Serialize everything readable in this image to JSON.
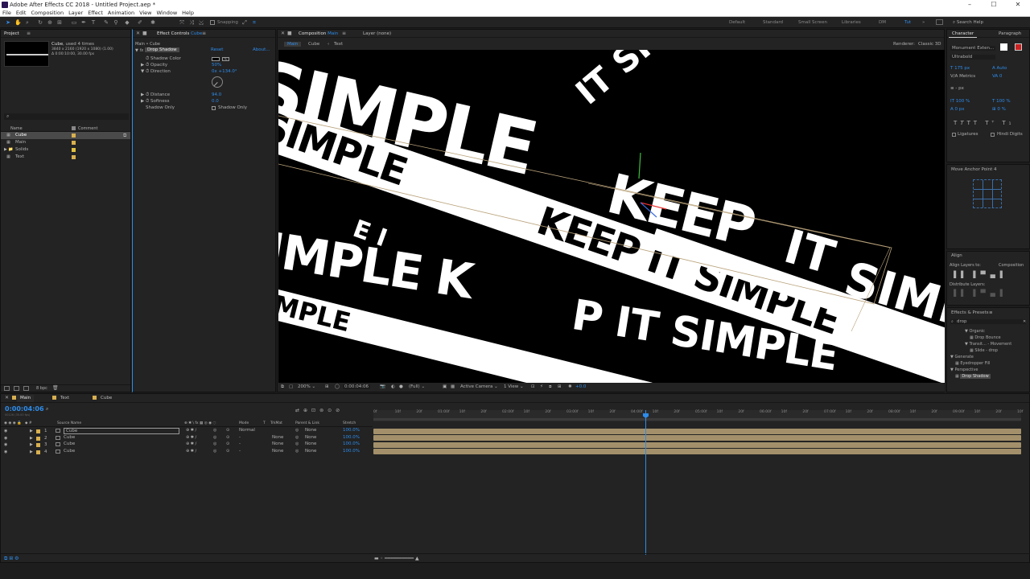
{
  "window": {
    "title": "Adobe After Effects CC 2018 - Untitled Project.aep *"
  },
  "menu": [
    "File",
    "Edit",
    "Composition",
    "Layer",
    "Effect",
    "Animation",
    "View",
    "Window",
    "Help"
  ],
  "toolbar": {
    "snapping_label": "Snapping"
  },
  "workspaces": [
    "Default",
    "Standard",
    "Small Screen",
    "Libraries",
    "DM",
    "Tut"
  ],
  "search_help": "Search Help",
  "project": {
    "tab": "Project",
    "selected_name": "Cube",
    "selected_info": ", used 4 times",
    "selected_dims": "3840 x 2160 (1920 x 1080) (1.00)",
    "selected_dur": "Δ 0:00:10:00, 30.00 fps",
    "columns": [
      "Name",
      "Comment"
    ],
    "items": [
      {
        "name": "Cube",
        "color": "#d8b050",
        "selected": true
      },
      {
        "name": "Main",
        "color": "#d8b050",
        "selected": false
      },
      {
        "name": "Solids",
        "color": "#e0c040",
        "selected": false
      },
      {
        "name": "Text",
        "color": "#d8b050",
        "selected": false
      }
    ],
    "footer_bpc": "8 bpc"
  },
  "effect_controls": {
    "tab": "Effect Controls",
    "tab_target": "Cube",
    "breadcrumb": "Main • Cube",
    "effect_name": "Drop Shadow",
    "reset": "Reset",
    "about": "About...",
    "props": [
      {
        "label": "Shadow Color",
        "value": ""
      },
      {
        "label": "Opacity",
        "value": "50%"
      },
      {
        "label": "Direction",
        "value": "0x +134.0°"
      },
      {
        "label": "Distance",
        "value": "94.0"
      },
      {
        "label": "Softness",
        "value": "0.0"
      },
      {
        "label": "Shadow Only",
        "value": "Shadow Only"
      }
    ]
  },
  "composition": {
    "tab": "Composition",
    "tab_target": "Main",
    "layer_tab": "Layer (none)",
    "crumbs": [
      "Main",
      "Cube",
      "Text"
    ],
    "renderer_label": "Renderer:",
    "renderer": "Classic 3D",
    "zoom": "200%",
    "timecode": "0:00:04:06",
    "resolution": "(Full)",
    "camera": "Active Camera",
    "view": "1 View",
    "exposure": "+0.0",
    "art": {
      "text_simple": "SIMPLE",
      "text_keep": "KEEP",
      "text_it": "IT",
      "text_keepit": "KEEP IT SIMPLE",
      "text_it_simple": "IT SIMPLE",
      "text_pit_simple": "P IT SIMPLE",
      "text_mple": "MPLE",
      "text_imple": "IMPLE",
      "text_imple_k": "IMPLE K",
      "text_ei": "E I"
    }
  },
  "character": {
    "tab": "Character",
    "tab2": "Paragraph",
    "font": "Monument Exten...",
    "style": "Ultrabold",
    "size": "175 px",
    "leading": "Auto",
    "kerning": "Metrics",
    "tracking": "0",
    "stroke": "- px",
    "vscale": "100 %",
    "hscale": "100 %",
    "baseline": "0 px",
    "tsume": "0 %",
    "ligatures": "Ligatures",
    "hindi": "Hindi Digits"
  },
  "anchor": {
    "title": "Move Anchor Point 4"
  },
  "align": {
    "title": "Align",
    "align_to_label": "Align Layers to:",
    "align_to": "Composition",
    "distribute": "Distribute Layers:"
  },
  "effects_presets": {
    "title": "Effects & Presets",
    "search": "drop",
    "items": [
      {
        "label": "Organic",
        "indent": 3
      },
      {
        "label": "Drop Bounce",
        "indent": 4
      },
      {
        "label": "Transit... - Movement",
        "indent": 3
      },
      {
        "label": "Slide - drop",
        "indent": 4
      },
      {
        "label": "Generate",
        "indent": 0
      },
      {
        "label": "Eyedropper Fill",
        "indent": 1
      },
      {
        "label": "Perspective",
        "indent": 0
      },
      {
        "label": "Drop Shadow",
        "indent": 1
      }
    ]
  },
  "timeline": {
    "tabs": [
      "Main",
      "Text",
      "Cube"
    ],
    "timecode": "0:00:04:06",
    "fps_label": "00126 (30.00 fps)",
    "columns": [
      "Source Name",
      "Mode",
      "T",
      "TrkMat",
      "Parent & Link",
      "Stretch"
    ],
    "layers": [
      {
        "num": "1",
        "name": "Cube",
        "mode": "Normal",
        "trkmat": "",
        "parent": "None",
        "stretch": "100.0%"
      },
      {
        "num": "2",
        "name": "Cube",
        "mode": "-",
        "trkmat": "None",
        "parent": "None",
        "stretch": "100.0%"
      },
      {
        "num": "3",
        "name": "Cube",
        "mode": "-",
        "trkmat": "None",
        "parent": "None",
        "stretch": "100.0%"
      },
      {
        "num": "4",
        "name": "Cube",
        "mode": "-",
        "trkmat": "None",
        "parent": "None",
        "stretch": "100.0%"
      }
    ],
    "ruler": [
      "0f",
      "10f",
      "20f",
      "01:00f",
      "10f",
      "20f",
      "02:00f",
      "10f",
      "20f",
      "03:00f",
      "10f",
      "20f",
      "04:00f",
      "10f",
      "20f",
      "05:00f",
      "10f",
      "20f",
      "06:00f",
      "10f",
      "20f",
      "07:00f",
      "10f",
      "20f",
      "08:00f",
      "10f",
      "20f",
      "09:00f",
      "10f",
      "20f",
      "10f"
    ]
  },
  "colors": {
    "accent": "#2d8ceb",
    "label_yellow": "#d8b050",
    "track": "#a3906a"
  }
}
